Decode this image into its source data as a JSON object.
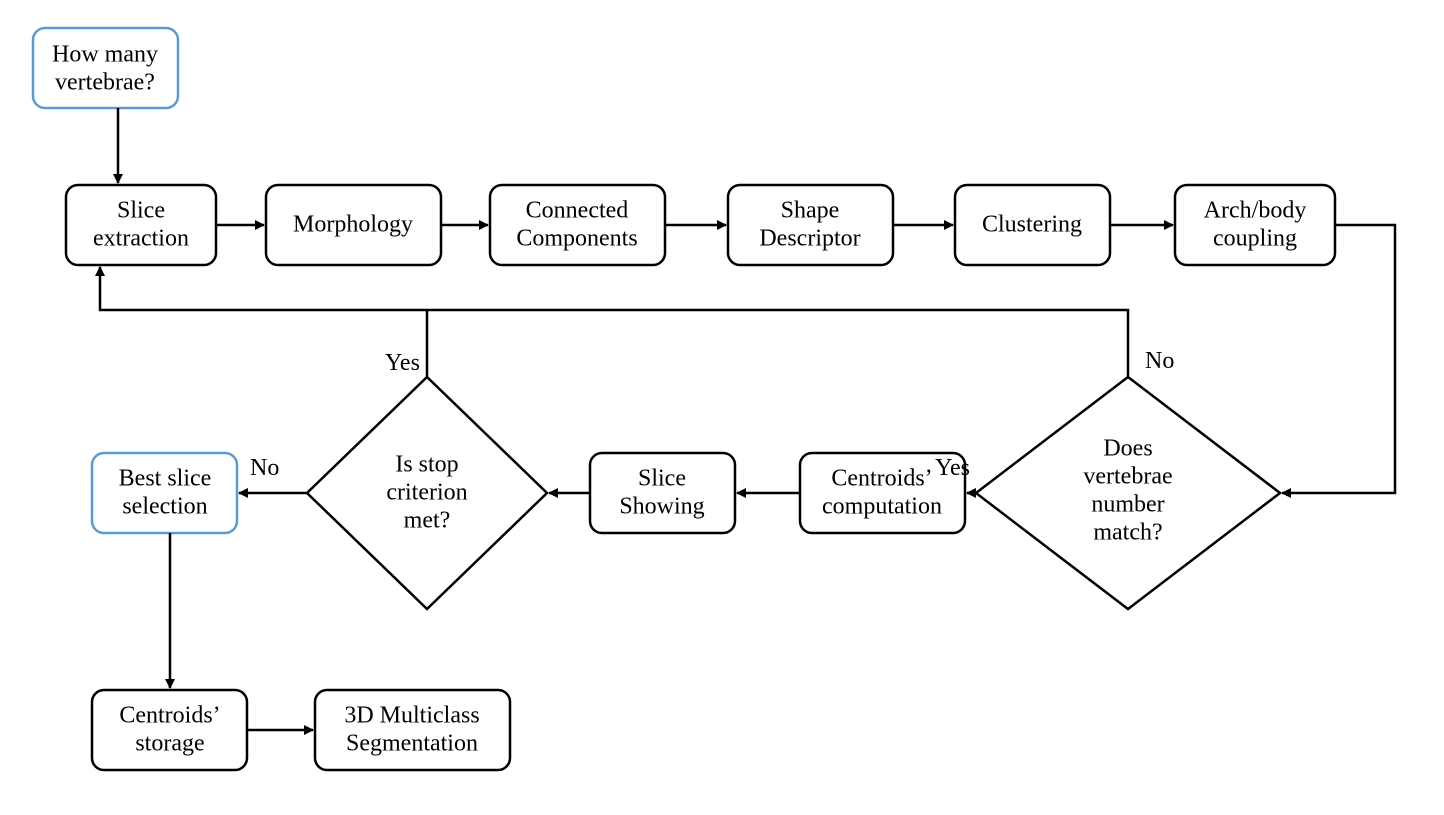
{
  "nodes": {
    "how_many": {
      "l1": "How many",
      "l2": "vertebrae?"
    },
    "slice_extraction": {
      "l1": "Slice",
      "l2": "extraction"
    },
    "morphology": {
      "l1": "Morphology"
    },
    "connected": {
      "l1": "Connected",
      "l2": "Components"
    },
    "shape_desc": {
      "l1": "Shape",
      "l2": "Descriptor"
    },
    "clustering": {
      "l1": "Clustering"
    },
    "arch_body": {
      "l1": "Arch/body",
      "l2": "coupling"
    },
    "vert_match": {
      "l1": "Does",
      "l2": "vertebrae",
      "l3": "number",
      "l4": "match?"
    },
    "centroids_comp": {
      "l1": "Centroids’",
      "l2": "computation"
    },
    "slice_showing": {
      "l1": "Slice",
      "l2": "Showing"
    },
    "stop_crit": {
      "l1": "Is stop",
      "l2": "criterion",
      "l3": "met?"
    },
    "best_slice": {
      "l1": "Best slice",
      "l2": "selection"
    },
    "centroids_store": {
      "l1": "Centroids’",
      "l2": "storage"
    },
    "seg3d": {
      "l1": "3D Multiclass",
      "l2": "Segmentation"
    }
  },
  "labels": {
    "no": "No",
    "yes": "Yes"
  }
}
